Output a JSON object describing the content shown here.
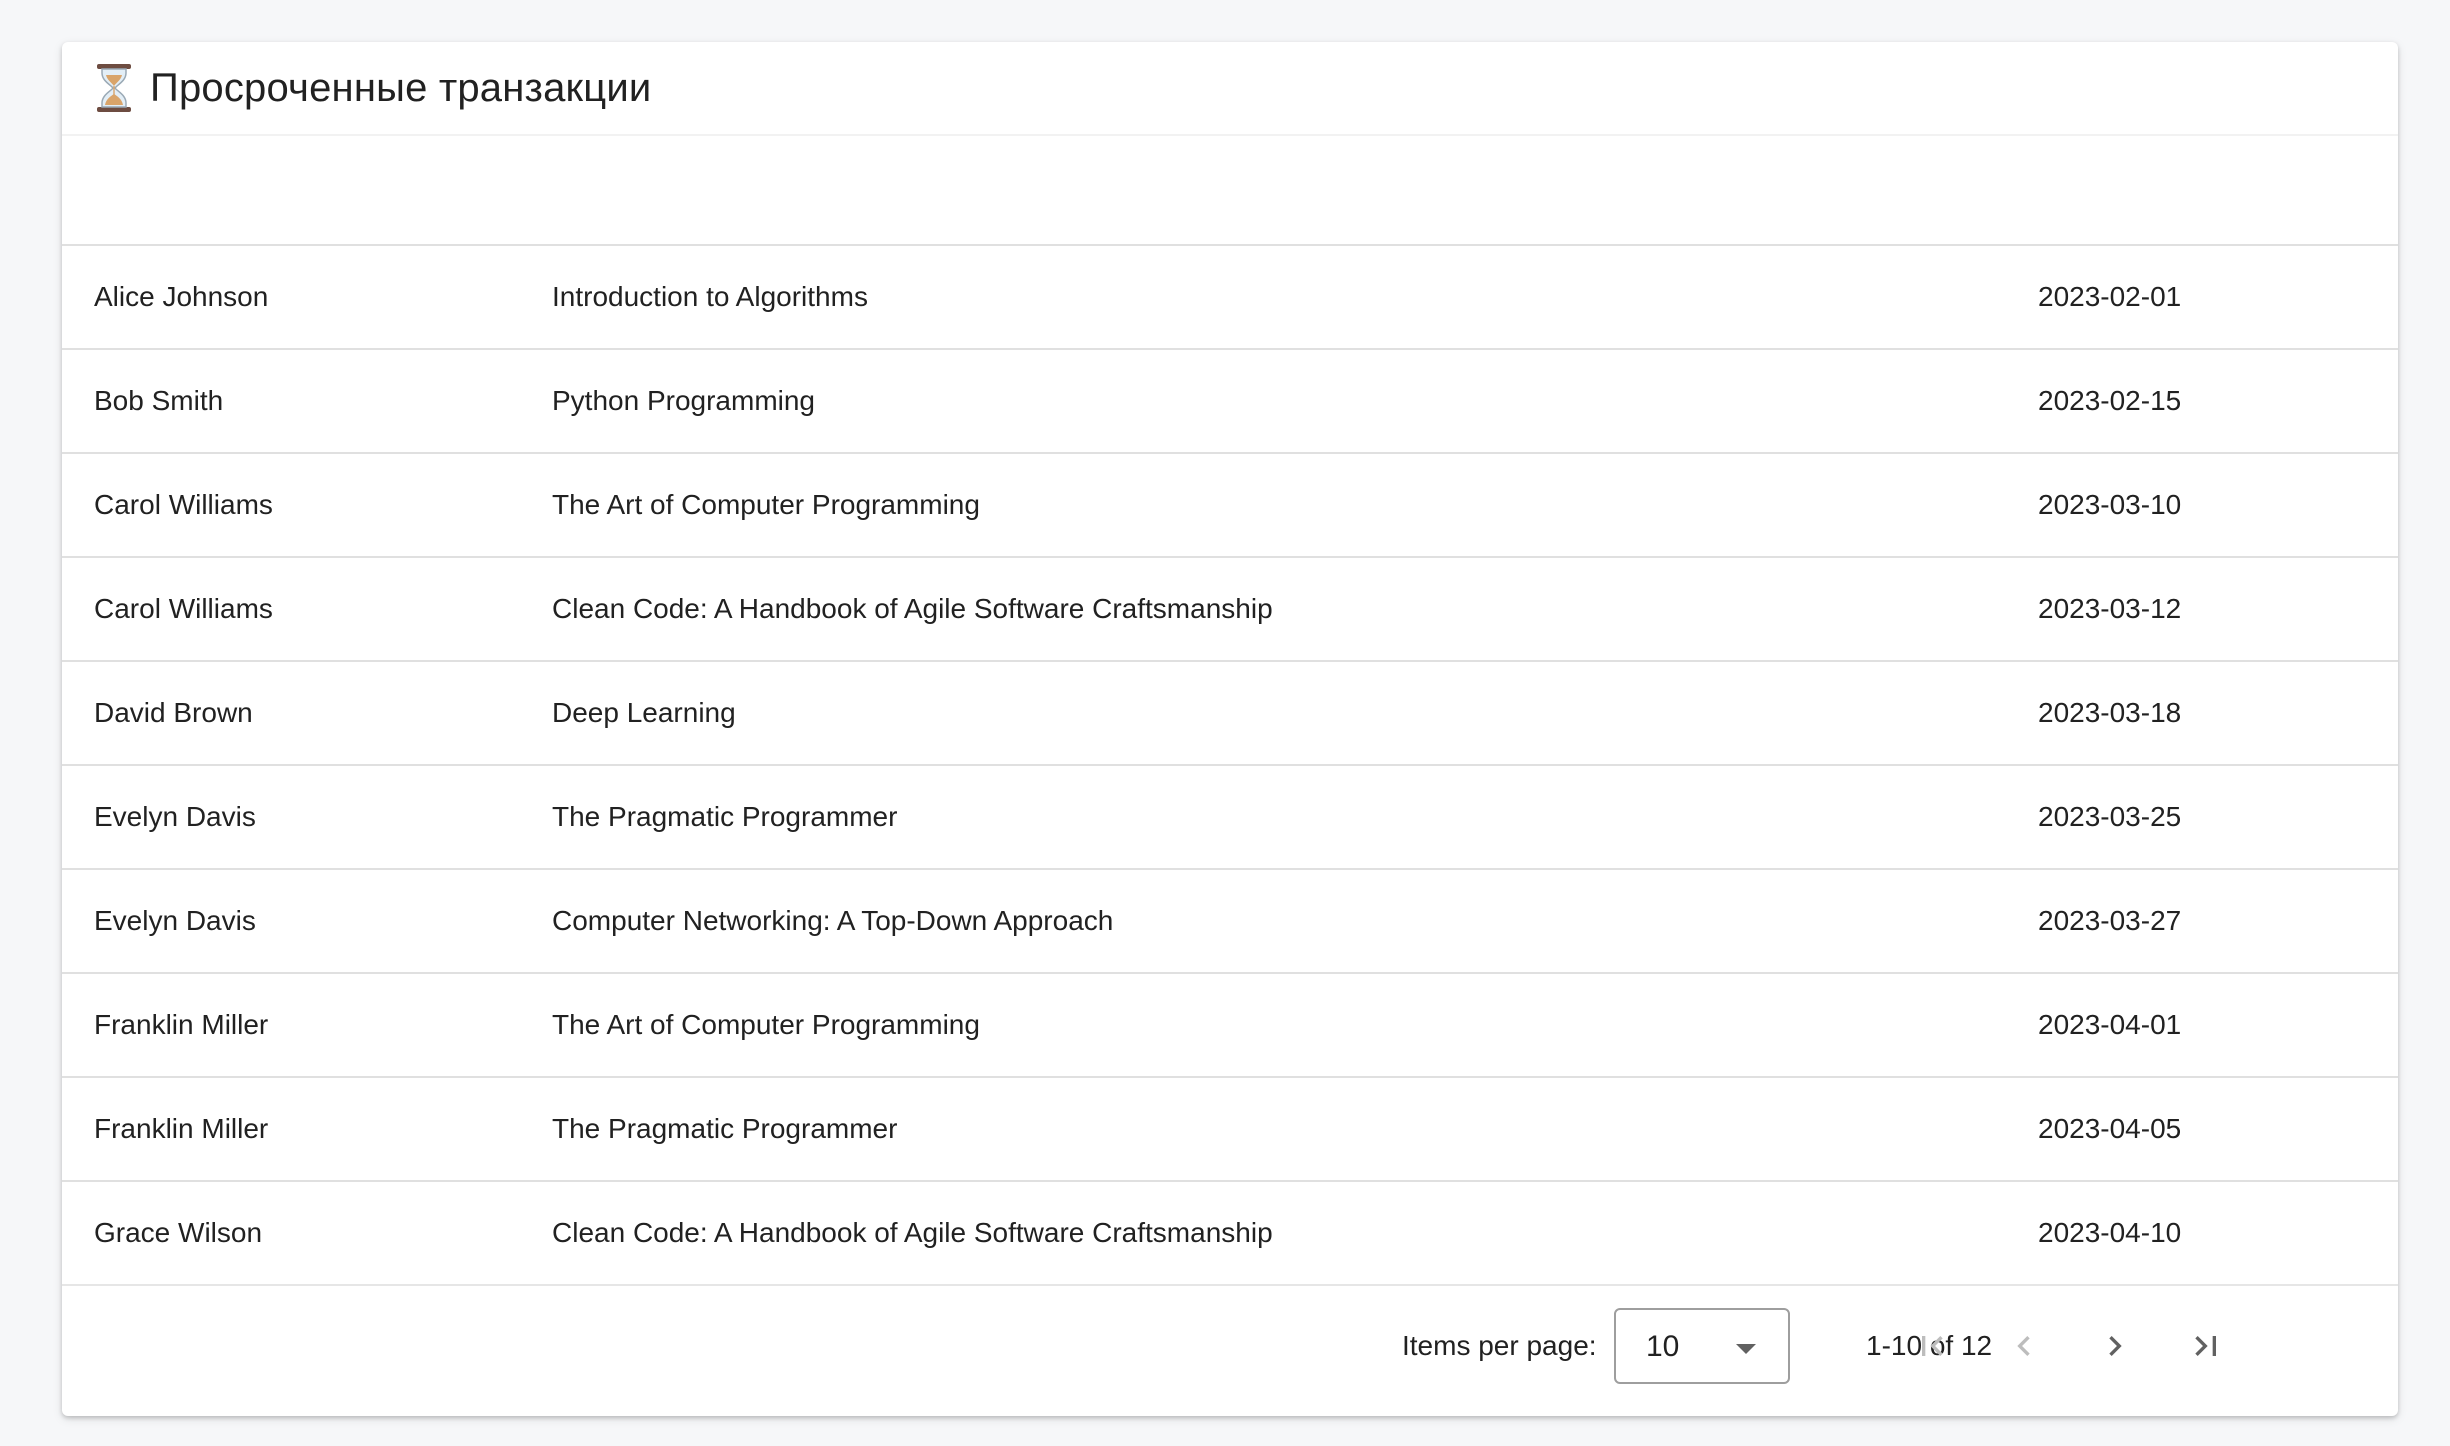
{
  "card": {
    "title_icon": "hourglass-icon",
    "title": "Просроченные транзакции"
  },
  "table": {
    "rows": [
      {
        "name": "Alice Johnson",
        "book": "Introduction to Algorithms",
        "date": "2023-02-01"
      },
      {
        "name": "Bob Smith",
        "book": "Python Programming",
        "date": "2023-02-15"
      },
      {
        "name": "Carol Williams",
        "book": "The Art of Computer Programming",
        "date": "2023-03-10"
      },
      {
        "name": "Carol Williams",
        "book": "Clean Code: A Handbook of Agile Software Craftsmanship",
        "date": "2023-03-12"
      },
      {
        "name": "David Brown",
        "book": "Deep Learning",
        "date": "2023-03-18"
      },
      {
        "name": "Evelyn Davis",
        "book": "The Pragmatic Programmer",
        "date": "2023-03-25"
      },
      {
        "name": "Evelyn Davis",
        "book": "Computer Networking: A Top-Down Approach",
        "date": "2023-03-27"
      },
      {
        "name": "Franklin Miller",
        "book": "The Art of Computer Programming",
        "date": "2023-04-01"
      },
      {
        "name": "Franklin Miller",
        "book": "The Pragmatic Programmer",
        "date": "2023-04-05"
      },
      {
        "name": "Grace Wilson",
        "book": "Clean Code: A Handbook of Agile Software Craftsmanship",
        "date": "2023-04-10"
      }
    ]
  },
  "paginator": {
    "items_per_page_label": "Items per page:",
    "items_per_page_value": "10",
    "range_label": "1-10 of 12",
    "first_icon": "first-page-icon",
    "prev_icon": "chevron-left-icon",
    "next_icon": "chevron-right-icon",
    "last_icon": "last-page-icon"
  },
  "colors": {
    "background": "#f6f7f9",
    "card": "#ffffff",
    "text": "#212121",
    "divider": "#e0e0e0",
    "disabled_icon": "#bdbdbd",
    "enabled_icon": "#616161"
  }
}
